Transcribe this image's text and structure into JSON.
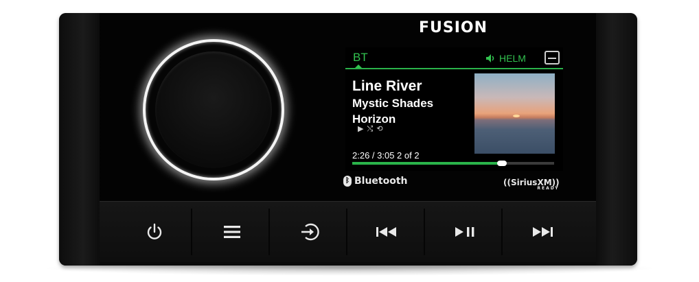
{
  "brand": {
    "logo_text": "FUSION"
  },
  "screen": {
    "source": "BT",
    "zone": "HELM",
    "track_title": "Line River",
    "artist": "Mystic Shades",
    "album": "Horizon",
    "status_glyphs": "▶ ⤭ ⟲",
    "time_text": "2:26 / 3:05 2 of 2",
    "progress_fraction": 0.74
  },
  "badges": {
    "bluetooth": "Bluetooth",
    "siriusxm": "((SiriusXM))",
    "siriusxm_sub": "READY"
  },
  "buttons": [
    {
      "name": "power-button",
      "icon": "power-icon"
    },
    {
      "name": "menu-button",
      "icon": "menu-icon"
    },
    {
      "name": "source-button",
      "icon": "source-enter-icon"
    },
    {
      "name": "previous-button",
      "icon": "skip-back-icon"
    },
    {
      "name": "play-pause-button",
      "icon": "play-pause-icon"
    },
    {
      "name": "next-button",
      "icon": "skip-forward-icon"
    }
  ]
}
